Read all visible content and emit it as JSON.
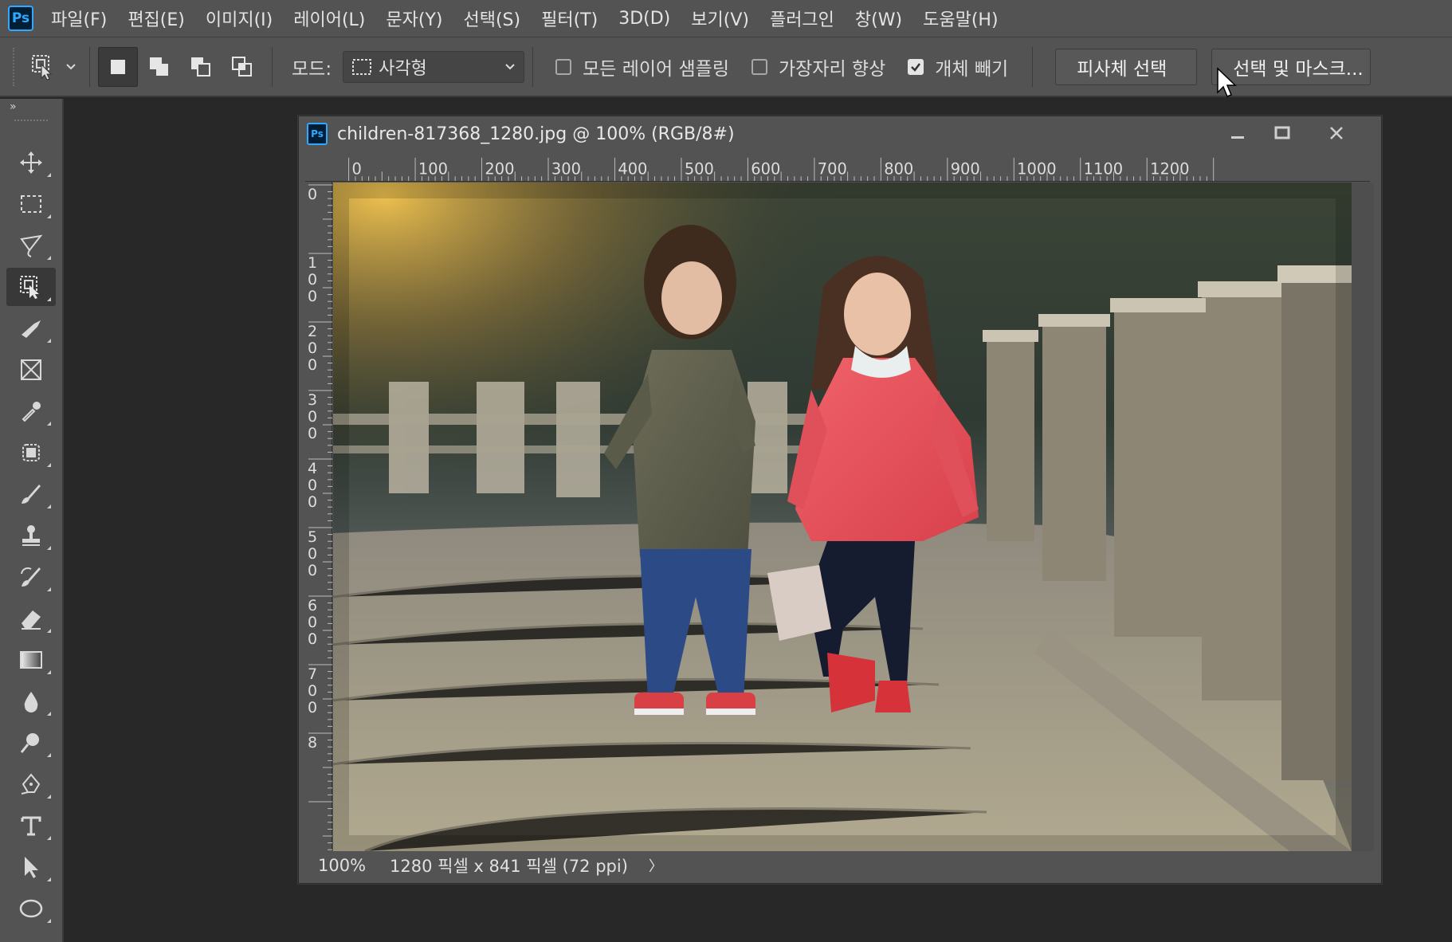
{
  "menu": [
    "파일(F)",
    "편집(E)",
    "이미지(I)",
    "레이어(L)",
    "문자(Y)",
    "선택(S)",
    "필터(T)",
    "3D(D)",
    "보기(V)",
    "플러그인",
    "창(W)",
    "도움말(H)"
  ],
  "app_logo": "Ps",
  "options": {
    "mode_label": "모드:",
    "mode_value": "사각형",
    "sample_all_layers": {
      "label": "모든 레이어 샘플링",
      "checked": false
    },
    "enhance_edge": {
      "label": "가장자리 향상",
      "checked": false
    },
    "object_subtract": {
      "label": "개체 빼기",
      "checked": true
    },
    "select_subject_button": "피사체 선택",
    "select_and_mask_button": "선택 및 마스크..."
  },
  "document": {
    "logo": "Ps",
    "title": "children-817368_1280.jpg @ 100% (RGB/8#)",
    "ruler_h_labels": [
      "0",
      "100",
      "200",
      "300",
      "400",
      "500",
      "600",
      "700",
      "800",
      "900",
      "1000",
      "1100",
      "1200"
    ],
    "ruler_v_labels": [
      "0",
      "100",
      "200",
      "300",
      "400",
      "500",
      "600",
      "700",
      "8"
    ],
    "zoom": "100%",
    "doc_info": "1280 픽셀 x 841 픽셀 (72 ppi)",
    "status_arrow": "〉"
  },
  "tools": [
    "move-tool",
    "rectangular-marquee-tool",
    "lasso-tool",
    "object-selection-tool",
    "brush-pen-tool",
    "frame-tool",
    "eyedropper-tool",
    "spot-healing-tool",
    "brush-tool",
    "clone-stamp-tool",
    "history-brush-tool",
    "eraser-tool",
    "gradient-tool",
    "blur-tool",
    "dodge-tool",
    "pen-tool",
    "type-tool",
    "path-selection-tool",
    "ellipse-tool"
  ],
  "colors": {
    "ui_panel": "#535353",
    "workspace": "#282828",
    "ps_blue": "#31a8ff"
  }
}
